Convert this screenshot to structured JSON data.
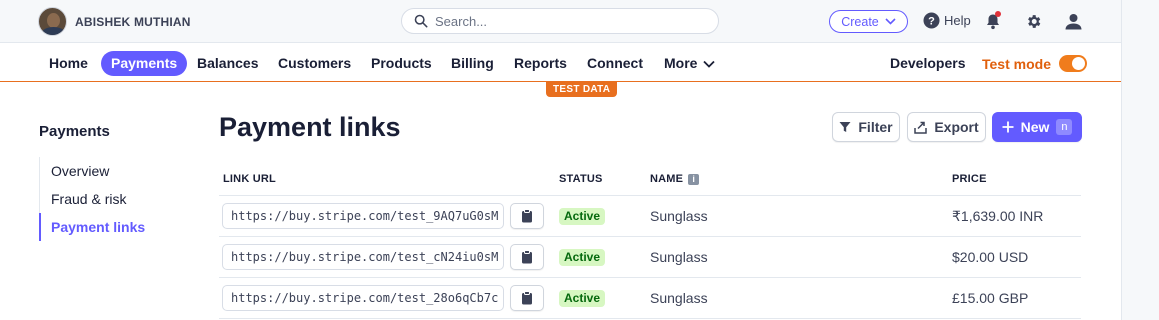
{
  "account": {
    "name": "ABISHEK MUTHIAN"
  },
  "search": {
    "placeholder": "Search..."
  },
  "topbar": {
    "create_label": "Create",
    "help_label": "Help"
  },
  "nav": {
    "items": [
      {
        "label": "Home"
      },
      {
        "label": "Payments",
        "active": true
      },
      {
        "label": "Balances"
      },
      {
        "label": "Customers"
      },
      {
        "label": "Products"
      },
      {
        "label": "Billing"
      },
      {
        "label": "Reports"
      },
      {
        "label": "Connect"
      },
      {
        "label": "More"
      }
    ],
    "developers_label": "Developers",
    "test_mode_label": "Test mode",
    "test_mode_on": true,
    "test_data_banner": "TEST DATA"
  },
  "sidebar": {
    "title": "Payments",
    "items": [
      {
        "label": "Overview"
      },
      {
        "label": "Fraud & risk"
      },
      {
        "label": "Payment links",
        "active": true
      }
    ]
  },
  "main": {
    "title": "Payment links",
    "filter_label": "Filter",
    "export_label": "Export",
    "new_label": "New",
    "new_shortcut": "n",
    "columns": [
      "LINK URL",
      "STATUS",
      "NAME",
      "PRICE"
    ],
    "rows": [
      {
        "url": "https://buy.stripe.com/test_9AQ7uG0sM",
        "status": "Active",
        "name": "Sunglass",
        "price": "₹1,639.00 INR"
      },
      {
        "url": "https://buy.stripe.com/test_cN24iu0sM",
        "status": "Active",
        "name": "Sunglass",
        "price": "$20.00 USD"
      },
      {
        "url": "https://buy.stripe.com/test_28o6qCb7c",
        "status": "Active",
        "name": "Sunglass",
        "price": "£15.00 GBP"
      }
    ]
  },
  "colors": {
    "accent": "#635bff",
    "test_mode": "#e86f1f",
    "status_active_bg": "#d7f7c2",
    "status_active_text": "#05690d"
  }
}
